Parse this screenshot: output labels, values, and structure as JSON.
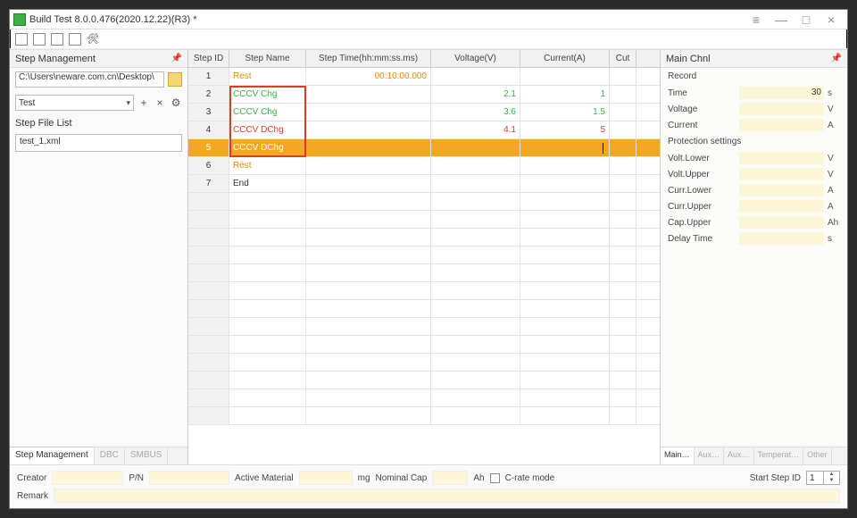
{
  "window": {
    "title": "Build Test 8.0.0.476(2020.12.22)(R3) *"
  },
  "left": {
    "panel_title": "Step Management",
    "path": "C:\\Users\\neware.com.cn\\Desktop\\",
    "combo_value": "Test",
    "file_list_label": "Step File List",
    "file_item": "test_1.xml",
    "tabs": {
      "a": "Step Management",
      "b": "DBC",
      "c": "SMBUS"
    }
  },
  "grid": {
    "headers": {
      "id": "Step ID",
      "name": "Step Name",
      "time": "Step Time(hh:mm:ss.ms)",
      "volt": "Voltage(V)",
      "curr": "Current(A)",
      "cut": "Cut"
    },
    "rows": [
      {
        "id": "1",
        "name": "Rest",
        "name_cls": "txt-orange",
        "time": "00:10:00.000",
        "time_cls": "txt-orange",
        "volt": "",
        "curr": ""
      },
      {
        "id": "2",
        "name": "CCCV Chg",
        "name_cls": "txt-green",
        "time": "",
        "time_cls": "",
        "volt": "2.1",
        "volt_cls": "txt-green",
        "curr": "1",
        "curr_cls": "txt-green"
      },
      {
        "id": "3",
        "name": "CCCV Chg",
        "name_cls": "txt-green",
        "time": "",
        "time_cls": "",
        "volt": "3.6",
        "volt_cls": "txt-green",
        "curr": "1.5",
        "curr_cls": "txt-green"
      },
      {
        "id": "4",
        "name": "CCCV DChg",
        "name_cls": "txt-red",
        "time": "",
        "time_cls": "",
        "volt": "4.1",
        "volt_cls": "txt-red",
        "curr": "5",
        "curr_cls": "txt-red"
      },
      {
        "id": "5",
        "name": "CCCV DChg",
        "name_cls": "",
        "time": "",
        "time_cls": "",
        "volt": "",
        "curr": "",
        "selected": true,
        "caret_curr": true
      },
      {
        "id": "6",
        "name": "Rest",
        "name_cls": "txt-orange",
        "time": "",
        "time_cls": "",
        "volt": "",
        "curr": ""
      },
      {
        "id": "7",
        "name": "End",
        "name_cls": "",
        "time": "",
        "time_cls": "",
        "volt": "",
        "curr": ""
      }
    ]
  },
  "right": {
    "title": "Main Chnl",
    "record_label": "Record",
    "fields": {
      "time": {
        "label": "Time",
        "value": "30",
        "unit": "s"
      },
      "voltage": {
        "label": "Voltage",
        "value": "",
        "unit": "V"
      },
      "current": {
        "label": "Current",
        "value": "",
        "unit": "A"
      }
    },
    "prot_label": "Protection settings",
    "prot": {
      "vlow": {
        "label": "Volt.Lower",
        "value": "",
        "unit": "V"
      },
      "vup": {
        "label": "Volt.Upper",
        "value": "",
        "unit": "V"
      },
      "clow": {
        "label": "Curr.Lower",
        "value": "",
        "unit": "A"
      },
      "cup": {
        "label": "Curr.Upper",
        "value": "",
        "unit": "A"
      },
      "capup": {
        "label": "Cap.Upper",
        "value": "",
        "unit": "Ah"
      },
      "delay": {
        "label": "Delay Time",
        "value": "",
        "unit": "s"
      }
    },
    "tabs": {
      "a": "Main…",
      "b": "Aux…",
      "c": "Aux…",
      "d": "Temperat…",
      "e": "Other"
    }
  },
  "footer": {
    "creator_lbl": "Creator",
    "pn_lbl": "P/N",
    "am_lbl": "Active Material",
    "am_unit": "mg",
    "nom_lbl": "Nominal Cap",
    "nom_unit": "Ah",
    "crate_lbl": "C-rate mode",
    "start_lbl": "Start Step ID",
    "start_val": "1",
    "remark_lbl": "Remark"
  }
}
